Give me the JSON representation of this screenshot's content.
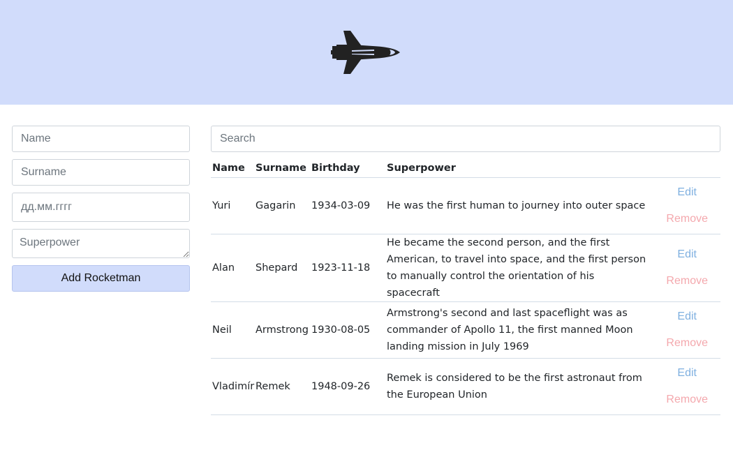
{
  "header": {
    "logo_icon": "space-shuttle-icon",
    "background": "#d1dcfb"
  },
  "form": {
    "name_placeholder": "Name",
    "surname_placeholder": "Surname",
    "birthday_placeholder": "дд.мм.гггг",
    "superpower_placeholder": "Superpower",
    "add_button": "Add Rocketman"
  },
  "list": {
    "search_placeholder": "Search",
    "columns": [
      "Name",
      "Surname",
      "Birthday",
      "Superpower"
    ],
    "rows": [
      {
        "name": "Yuri",
        "surname": "Gagarin",
        "birthday": "1934-03-09",
        "superpower": "He was the first human to journey into outer space",
        "edit": "Edit",
        "remove": "Remove"
      },
      {
        "name": "Alan",
        "surname": "Shepard",
        "birthday": "1923-11-18",
        "superpower": "He became the second person, and the first American, to travel into space, and the first person to manually control the orientation of his spacecraft",
        "edit": "Edit",
        "remove": "Remove"
      },
      {
        "name": "Neil",
        "surname": "Armstrong",
        "birthday": "1930-08-05",
        "superpower": "Armstrong's second and last spaceflight was as commander of Apollo 11, the first manned Moon landing mission in July 1969",
        "edit": "Edit",
        "remove": "Remove"
      },
      {
        "name": "Vladimír",
        "surname": "Remek",
        "birthday": "1948-09-26",
        "superpower": "Remek is considered to be the first astronaut from the European Union",
        "edit": "Edit",
        "remove": "Remove"
      }
    ]
  },
  "colors": {
    "edit": "#7fb0e0",
    "remove": "#f4a8ad",
    "accent": "#d1dcfb"
  }
}
